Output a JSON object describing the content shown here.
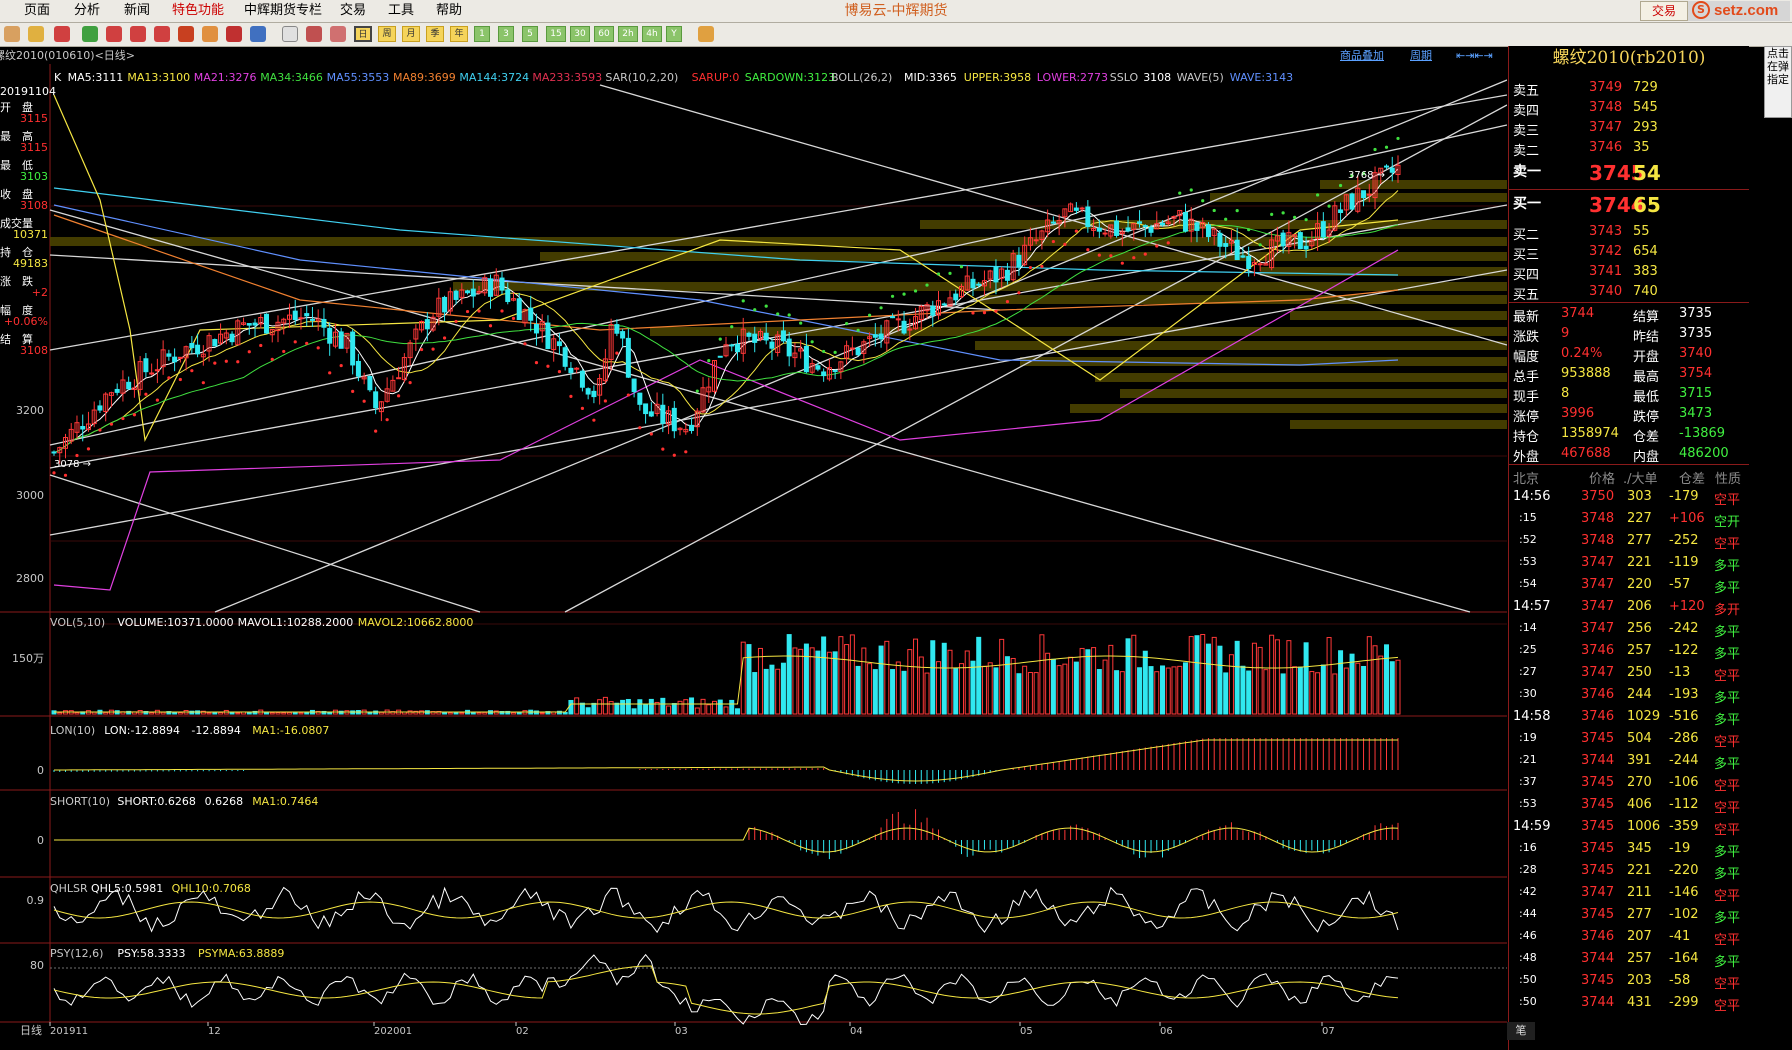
{
  "window": {
    "app_title": "博易云-中辉期货",
    "trade_button": "交易",
    "logo_text": "setz.com",
    "menu": [
      "页面",
      "分析",
      "新闻",
      "特色功能",
      "中辉期货专栏",
      "交易",
      "工具",
      "帮助"
    ],
    "side_button": "点击在弹指定"
  },
  "toolbar": {
    "periods": [
      "周",
      "月",
      "季",
      "年",
      "1",
      "3",
      "5",
      "15",
      "30",
      "60",
      "2h",
      "4h",
      "Y"
    ]
  },
  "chart": {
    "header_left": "螺纹2010(010610)<日线>",
    "header_right": [
      "商品叠加",
      "周期"
    ],
    "indicators_main": [
      {
        "text": "K",
        "color": "#ffffff"
      },
      {
        "text": "MA5:3111",
        "color": "#ffffff"
      },
      {
        "text": "MA13:3100",
        "color": "#f5e642"
      },
      {
        "text": "MA21:3276",
        "color": "#e040e0"
      },
      {
        "text": "MA34:3466",
        "color": "#40e040"
      },
      {
        "text": "MA55:3553",
        "color": "#6090ff"
      },
      {
        "text": "MA89:3699",
        "color": "#f08030"
      },
      {
        "text": "MA144:3724",
        "color": "#40d0f0"
      },
      {
        "text": "MA233:3593",
        "color": "#e03050"
      },
      {
        "text": "SAR(10,2,20)",
        "color": "#c8c8c8"
      },
      {
        "text": "SARUP:0",
        "color": "#ff3030"
      },
      {
        "text": "SARDOWN:3123",
        "color": "#40f040"
      },
      {
        "text": "BOLL(26,2)",
        "color": "#c8c8c8"
      },
      {
        "text": "MID:3365",
        "color": "#ffffff"
      },
      {
        "text": "UPPER:3958",
        "color": "#f5e642"
      },
      {
        "text": "LOWER:2773",
        "color": "#e040e0"
      },
      {
        "text": "SSLO",
        "color": "#c8c8c8"
      },
      {
        "text": "3108",
        "color": "#ffffff"
      },
      {
        "text": "WAVE(5)",
        "color": "#c8c8c8"
      },
      {
        "text": "WAVE:3143",
        "color": "#6090ff"
      }
    ],
    "left_info": {
      "date": "20191104",
      "items": [
        {
          "label": "开　盘",
          "value": "3115"
        },
        {
          "label": "最　高",
          "value": "3115"
        },
        {
          "label": "最　低",
          "value": "3103"
        },
        {
          "label": "收　盘",
          "value": "3108"
        },
        {
          "label": "成交量",
          "value": "10371"
        },
        {
          "label": "持　仓",
          "value": "49183"
        },
        {
          "label": "涨　跌",
          "value": "+2"
        },
        {
          "label": "幅　度",
          "value": "+0.06%"
        },
        {
          "label": "结　算",
          "value": "3108"
        }
      ]
    },
    "price_axis": [
      "3200",
      "3000",
      "2800"
    ],
    "high_label": "3768",
    "low_label": "3078",
    "vol_header": [
      {
        "text": "VOL(5,10)",
        "color": "#c8c8c8"
      },
      {
        "text": "VOLUME:10371.0000",
        "color": "#ffffff"
      },
      {
        "text": "MAVOL1:10288.2000",
        "color": "#ffffff"
      },
      {
        "text": "MAVOL2:10662.8000",
        "color": "#f5e642"
      }
    ],
    "vol_axis": "150万",
    "lon_header": [
      {
        "text": "LON(10)",
        "color": "#c8c8c8"
      },
      {
        "text": "LON:-12.8894",
        "color": "#ffffff"
      },
      {
        "text": "-12.8894",
        "color": "#ffffff"
      },
      {
        "text": "MA1:-16.0807",
        "color": "#f5e642"
      }
    ],
    "lon_axis": "0",
    "short_header": [
      {
        "text": "SHORT(10)",
        "color": "#c8c8c8"
      },
      {
        "text": "SHORT:0.6268",
        "color": "#ffffff"
      },
      {
        "text": "0.6268",
        "color": "#ffffff"
      },
      {
        "text": "MA1:0.7464",
        "color": "#f5e642"
      }
    ],
    "short_axis": "0",
    "qhlsr_header": [
      {
        "text": "QHLSR",
        "color": "#c8c8c8"
      },
      {
        "text": "QHL5:0.5981",
        "color": "#ffffff"
      },
      {
        "text": "QHL10:0.7068",
        "color": "#f5e642"
      }
    ],
    "qhlsr_axis": "0.9",
    "psy_header": [
      {
        "text": "PSY(12,6)",
        "color": "#c8c8c8"
      },
      {
        "text": "PSY:58.3333",
        "color": "#ffffff"
      },
      {
        "text": "PSYMA:63.8889",
        "color": "#f5e642"
      }
    ],
    "psy_axis": "80",
    "date_axis_label": "日线",
    "date_axis": [
      "201911",
      "12",
      "202001",
      "02",
      "03",
      "04",
      "05",
      "06",
      "07"
    ]
  },
  "quote": {
    "title": "螺纹2010(rb2010)",
    "asks": [
      {
        "label": "卖五",
        "price": "3749",
        "vol": "729"
      },
      {
        "label": "卖四",
        "price": "3748",
        "vol": "545"
      },
      {
        "label": "卖三",
        "price": "3747",
        "vol": "293"
      },
      {
        "label": "卖二",
        "price": "3746",
        "vol": "35"
      },
      {
        "label": "卖一",
        "price": "3745",
        "vol": "54"
      }
    ],
    "bids": [
      {
        "label": "买一",
        "price": "3744",
        "vol": "65"
      },
      {
        "label": "买二",
        "price": "3743",
        "vol": "55"
      },
      {
        "label": "买三",
        "price": "3742",
        "vol": "654"
      },
      {
        "label": "买四",
        "price": "3741",
        "vol": "383"
      },
      {
        "label": "买五",
        "price": "3740",
        "vol": "740"
      }
    ],
    "stats": [
      {
        "l1": "最新",
        "v1": "3744",
        "c1": "#ff3030",
        "l2": "结算",
        "v2": "3735",
        "c2": "#ffffff"
      },
      {
        "l1": "涨跌",
        "v1": "9",
        "c1": "#ff3030",
        "l2": "昨结",
        "v2": "3735",
        "c2": "#ffffff"
      },
      {
        "l1": "幅度",
        "v1": "0.24%",
        "c1": "#ff3030",
        "l2": "开盘",
        "v2": "3740",
        "c2": "#ff3030"
      },
      {
        "l1": "总手",
        "v1": "953888",
        "c1": "#f5e642",
        "l2": "最高",
        "v2": "3754",
        "c2": "#ff3030"
      },
      {
        "l1": "现手",
        "v1": "8",
        "c1": "#f5e642",
        "l2": "最低",
        "v2": "3715",
        "c2": "#40f040"
      },
      {
        "l1": "涨停",
        "v1": "3996",
        "c1": "#ff3030",
        "l2": "跌停",
        "v2": "3473",
        "c2": "#40f040"
      },
      {
        "l1": "持仓",
        "v1": "1358974",
        "c1": "#f5e642",
        "l2": "仓差",
        "v2": "-13869",
        "c2": "#40f040"
      },
      {
        "l1": "外盘",
        "v1": "467688",
        "c1": "#ff3030",
        "l2": "内盘",
        "v2": "486200",
        "c2": "#40f040"
      }
    ],
    "tick_header": [
      "北京",
      "价格",
      "./大单",
      "仓差",
      "性质"
    ],
    "ticks": [
      {
        "t": "14:56",
        "p": "3750",
        "v": "303",
        "d": "-179",
        "n": "空平",
        "nc": "#ff3030"
      },
      {
        "t": ":15",
        "p": "3748",
        "v": "227",
        "d": "+106",
        "n": "空开",
        "nc": "#40f040"
      },
      {
        "t": ":52",
        "p": "3748",
        "v": "277",
        "d": "-252",
        "n": "空平",
        "nc": "#ff3030"
      },
      {
        "t": ":53",
        "p": "3747",
        "v": "221",
        "d": "-119",
        "n": "多平",
        "nc": "#40f040"
      },
      {
        "t": ":54",
        "p": "3747",
        "v": "220",
        "d": "-57",
        "n": "多平",
        "nc": "#40f040"
      },
      {
        "t": "14:57",
        "p": "3747",
        "v": "206",
        "d": "+120",
        "n": "多开",
        "nc": "#ff3030"
      },
      {
        "t": ":14",
        "p": "3747",
        "v": "256",
        "d": "-242",
        "n": "多平",
        "nc": "#40f040"
      },
      {
        "t": ":25",
        "p": "3746",
        "v": "257",
        "d": "-122",
        "n": "多平",
        "nc": "#40f040"
      },
      {
        "t": ":27",
        "p": "3747",
        "v": "250",
        "d": "-13",
        "n": "空平",
        "nc": "#ff3030"
      },
      {
        "t": ":30",
        "p": "3746",
        "v": "244",
        "d": "-193",
        "n": "多平",
        "nc": "#40f040"
      },
      {
        "t": "14:58",
        "p": "3746",
        "v": "1029",
        "d": "-516",
        "n": "多平",
        "nc": "#40f040"
      },
      {
        "t": ":19",
        "p": "3745",
        "v": "504",
        "d": "-286",
        "n": "空平",
        "nc": "#ff3030"
      },
      {
        "t": ":21",
        "p": "3744",
        "v": "391",
        "d": "-244",
        "n": "多平",
        "nc": "#40f040"
      },
      {
        "t": ":37",
        "p": "3745",
        "v": "270",
        "d": "-106",
        "n": "空平",
        "nc": "#ff3030"
      },
      {
        "t": ":53",
        "p": "3745",
        "v": "406",
        "d": "-112",
        "n": "空平",
        "nc": "#ff3030"
      },
      {
        "t": "14:59",
        "p": "3745",
        "v": "1006",
        "d": "-359",
        "n": "空平",
        "nc": "#ff3030"
      },
      {
        "t": ":16",
        "p": "3745",
        "v": "345",
        "d": "-19",
        "n": "多平",
        "nc": "#40f040"
      },
      {
        "t": ":28",
        "p": "3745",
        "v": "221",
        "d": "-220",
        "n": "多平",
        "nc": "#40f040"
      },
      {
        "t": ":42",
        "p": "3747",
        "v": "211",
        "d": "-146",
        "n": "空平",
        "nc": "#ff3030"
      },
      {
        "t": ":44",
        "p": "3745",
        "v": "277",
        "d": "-102",
        "n": "多平",
        "nc": "#40f040"
      },
      {
        "t": ":46",
        "p": "3746",
        "v": "207",
        "d": "-41",
        "n": "空平",
        "nc": "#ff3030"
      },
      {
        "t": ":48",
        "p": "3744",
        "v": "257",
        "d": "-164",
        "n": "多平",
        "nc": "#40f040"
      },
      {
        "t": ":50",
        "p": "3745",
        "v": "203",
        "d": "-58",
        "n": "空平",
        "nc": "#ff3030"
      },
      {
        "t": ":50",
        "p": "3744",
        "v": "431",
        "d": "-299",
        "n": "空平",
        "nc": "#ff3030"
      }
    ],
    "bottom_tab": "笔"
  }
}
